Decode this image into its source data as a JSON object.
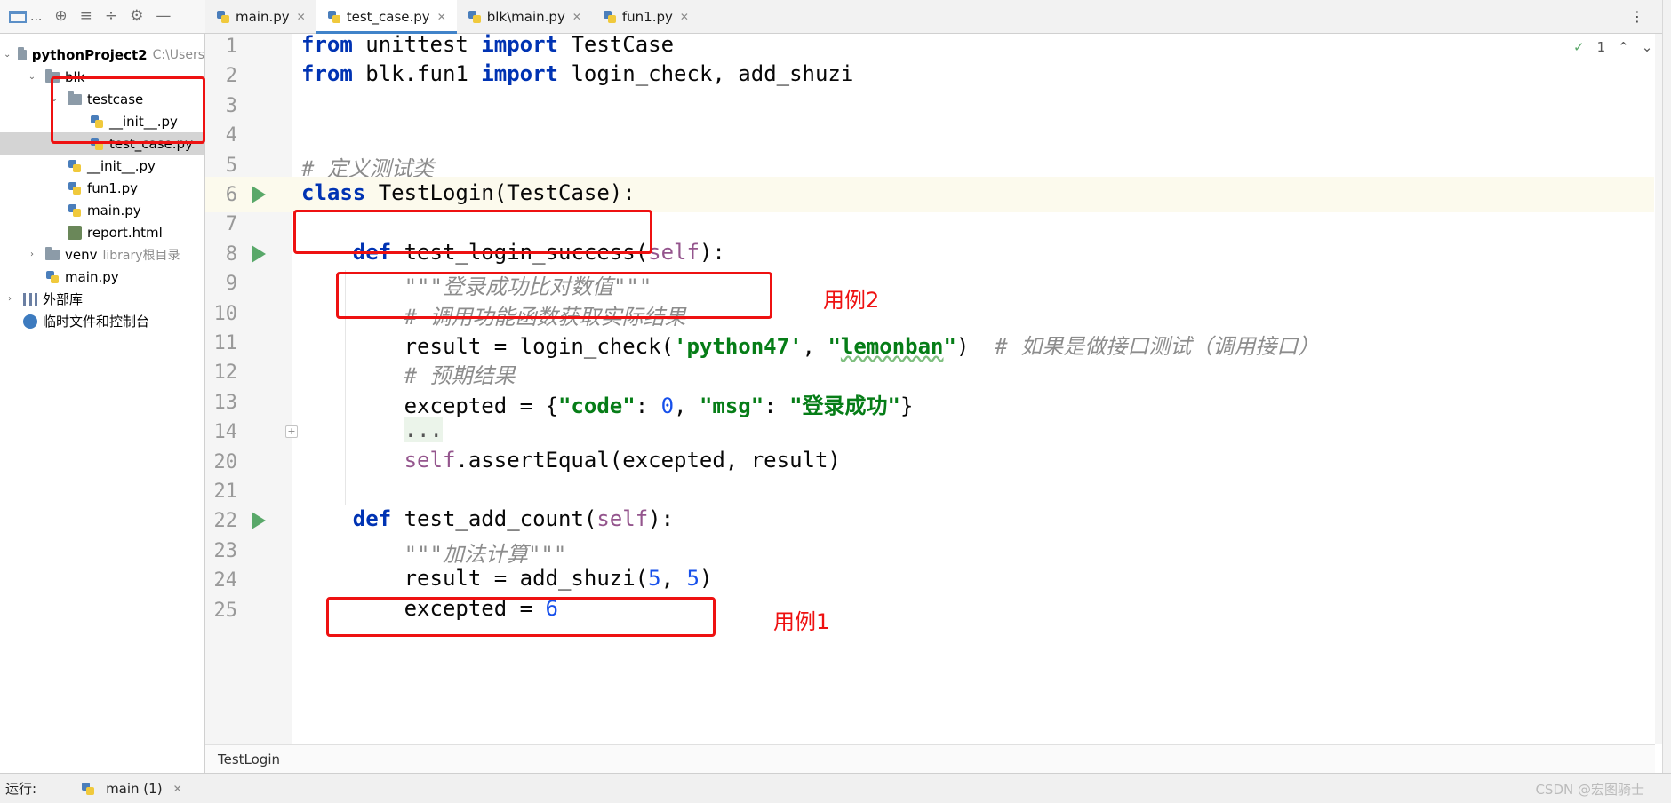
{
  "project_toolbar": {
    "label": "..."
  },
  "tree": [
    {
      "label": "pythonProject2",
      "hint": "C:\\Users",
      "bold": true,
      "arrow": "open",
      "icon": "folder",
      "indent": 0
    },
    {
      "label": "blk",
      "hint": "",
      "arrow": "open",
      "icon": "folder",
      "indent": 1
    },
    {
      "label": "testcase",
      "hint": "",
      "arrow": "open",
      "icon": "folder",
      "indent": 2
    },
    {
      "label": "__init__.py",
      "hint": "",
      "arrow": "none",
      "icon": "py",
      "indent": 3
    },
    {
      "label": "test_case.py",
      "hint": "",
      "arrow": "none",
      "icon": "py",
      "indent": 3,
      "selected": true
    },
    {
      "label": "__init__.py",
      "hint": "",
      "arrow": "none",
      "icon": "py",
      "indent": 2
    },
    {
      "label": "fun1.py",
      "hint": "",
      "arrow": "none",
      "icon": "py",
      "indent": 2
    },
    {
      "label": "main.py",
      "hint": "",
      "arrow": "none",
      "icon": "py",
      "indent": 2
    },
    {
      "label": "report.html",
      "hint": "",
      "arrow": "none",
      "icon": "html",
      "indent": 2
    },
    {
      "label": "venv",
      "hint": "library根目录",
      "arrow": "closed",
      "icon": "folder",
      "indent": 1
    },
    {
      "label": "main.py",
      "hint": "",
      "arrow": "none",
      "icon": "py",
      "indent": 1
    },
    {
      "label": "外部库",
      "hint": "",
      "arrow": "closed",
      "icon": "lib",
      "indent": 0
    },
    {
      "label": "临时文件和控制台",
      "hint": "",
      "arrow": "none",
      "icon": "scratch",
      "indent": 0
    }
  ],
  "tabs": [
    {
      "label": "main.py",
      "active": false
    },
    {
      "label": "test_case.py",
      "active": true
    },
    {
      "label": "blk\\main.py",
      "active": false
    },
    {
      "label": "fun1.py",
      "active": false
    }
  ],
  "inspection": {
    "count": "1"
  },
  "code_lines": [
    {
      "num": "1",
      "tokens": [
        [
          "kw",
          "from"
        ],
        [
          "p",
          " unittest "
        ],
        [
          "kw",
          "import"
        ],
        [
          "p",
          " TestCase"
        ]
      ]
    },
    {
      "num": "2",
      "tokens": [
        [
          "kw",
          "from"
        ],
        [
          "p",
          " blk.fun1 "
        ],
        [
          "kw",
          "import"
        ],
        [
          "p",
          " login_check, add_shuzi"
        ]
      ]
    },
    {
      "num": "3",
      "tokens": []
    },
    {
      "num": "4",
      "tokens": []
    },
    {
      "num": "5",
      "tokens": [
        [
          "com",
          "# 定义测试类"
        ]
      ]
    },
    {
      "num": "6",
      "tokens": [
        [
          "kw",
          "class"
        ],
        [
          "p",
          " TestLogin(TestCase):"
        ]
      ],
      "current": true,
      "run": true
    },
    {
      "num": "7",
      "tokens": []
    },
    {
      "num": "8",
      "tokens": [
        [
          "p",
          "    "
        ],
        [
          "kw",
          "def"
        ],
        [
          "p",
          " test_login_success("
        ],
        [
          "slf",
          "self"
        ],
        [
          "p",
          "):"
        ]
      ],
      "run": true
    },
    {
      "num": "9",
      "tokens": [
        [
          "p",
          "        "
        ],
        [
          "doc",
          "\"\"\"登录成功比对数值\"\"\""
        ]
      ]
    },
    {
      "num": "10",
      "tokens": [
        [
          "p",
          "        "
        ],
        [
          "com",
          "# 调用功能函数获取实际结果"
        ]
      ]
    },
    {
      "num": "11",
      "tokens": [
        [
          "p",
          "        result = login_check("
        ],
        [
          "str",
          "'python47'"
        ],
        [
          "p",
          ", "
        ],
        [
          "str",
          "\""
        ],
        [
          "sq",
          "lemonban"
        ],
        [
          "str",
          "\""
        ],
        [
          "p",
          ")  "
        ],
        [
          "com",
          "# 如果是做接口测试（调用接口）"
        ]
      ]
    },
    {
      "num": "12",
      "tokens": [
        [
          "p",
          "        "
        ],
        [
          "com",
          "# 预期结果"
        ]
      ]
    },
    {
      "num": "13",
      "tokens": [
        [
          "p",
          "        excepted = {"
        ],
        [
          "str",
          "\"code\""
        ],
        [
          "p",
          ": "
        ],
        [
          "num",
          "0"
        ],
        [
          "p",
          ", "
        ],
        [
          "str",
          "\"msg\""
        ],
        [
          "p",
          ": "
        ],
        [
          "str",
          "\"登录成功\""
        ],
        [
          "p",
          "}"
        ]
      ]
    },
    {
      "num": "14",
      "tokens": [
        [
          "p",
          "        "
        ],
        [
          "ell",
          "..."
        ]
      ],
      "fold": "+"
    },
    {
      "num": "20",
      "tokens": [
        [
          "p",
          "        "
        ],
        [
          "slf",
          "self"
        ],
        [
          "p",
          ".assertEqual(excepted, result)"
        ]
      ]
    },
    {
      "num": "21",
      "tokens": []
    },
    {
      "num": "22",
      "tokens": [
        [
          "p",
          "    "
        ],
        [
          "kw",
          "def"
        ],
        [
          "p",
          " test_add_count("
        ],
        [
          "slf",
          "self"
        ],
        [
          "p",
          "):"
        ]
      ],
      "run": true
    },
    {
      "num": "23",
      "tokens": [
        [
          "p",
          "        "
        ],
        [
          "doc",
          "\"\"\"加法计算\"\"\""
        ]
      ]
    },
    {
      "num": "24",
      "tokens": [
        [
          "p",
          "        result = add_shuzi("
        ],
        [
          "num",
          "5"
        ],
        [
          "p",
          ", "
        ],
        [
          "num",
          "5"
        ],
        [
          "p",
          ")"
        ]
      ]
    },
    {
      "num": "25",
      "tokens": [
        [
          "p",
          "        excepted = "
        ],
        [
          "num",
          "6"
        ]
      ]
    }
  ],
  "annotations": {
    "label_case2": "用例2",
    "label_case1": "用例1"
  },
  "breadcrumb": "TestLogin",
  "run_bar": {
    "label": "运行:",
    "tab": "main (1)"
  },
  "watermark": "CSDN @宏图骑士",
  "colors": {
    "keyword": "#0033b3",
    "string": "#067d17",
    "comment": "#8c8c8c",
    "self": "#94558d",
    "number": "#1750eb",
    "annotation": "#ee1111",
    "active_tab": "#4083c9"
  }
}
